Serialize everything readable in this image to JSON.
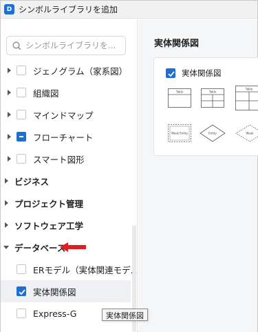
{
  "window": {
    "title": "シンボルライブラリを追加",
    "app_icon_letter": "D"
  },
  "search": {
    "placeholder": "シンボルライブラリを..."
  },
  "tree": {
    "items": [
      {
        "label": "ジェノグラム（家系図）",
        "checked": false
      },
      {
        "label": "組織図",
        "checked": false
      },
      {
        "label": "マインドマップ",
        "checked": false
      },
      {
        "label": "フローチャート",
        "checked": "partial"
      },
      {
        "label": "スマート図形",
        "checked": false
      }
    ],
    "categories": [
      {
        "label": "ビジネス"
      },
      {
        "label": "プロジェクト管理"
      },
      {
        "label": "ソフトウェア工学"
      },
      {
        "label": "データベース"
      }
    ],
    "db_items": [
      {
        "label": "ERモデル（実体関連モデ...",
        "checked": false
      },
      {
        "label": "実体関係図",
        "checked": true
      },
      {
        "label": "Express-G",
        "checked": false
      }
    ]
  },
  "tooltip": {
    "text": "実体関係図"
  },
  "main": {
    "section_title": "実体関係図",
    "card_label": "実体関係図",
    "shapes": {
      "table_label": "Table",
      "weak_entity_label": "Weak Entity",
      "entity_label": "Entity",
      "weak_label": "Weak"
    }
  },
  "colors": {
    "accent": "#1f6fd1",
    "annotation_arrow": "#e02020"
  }
}
